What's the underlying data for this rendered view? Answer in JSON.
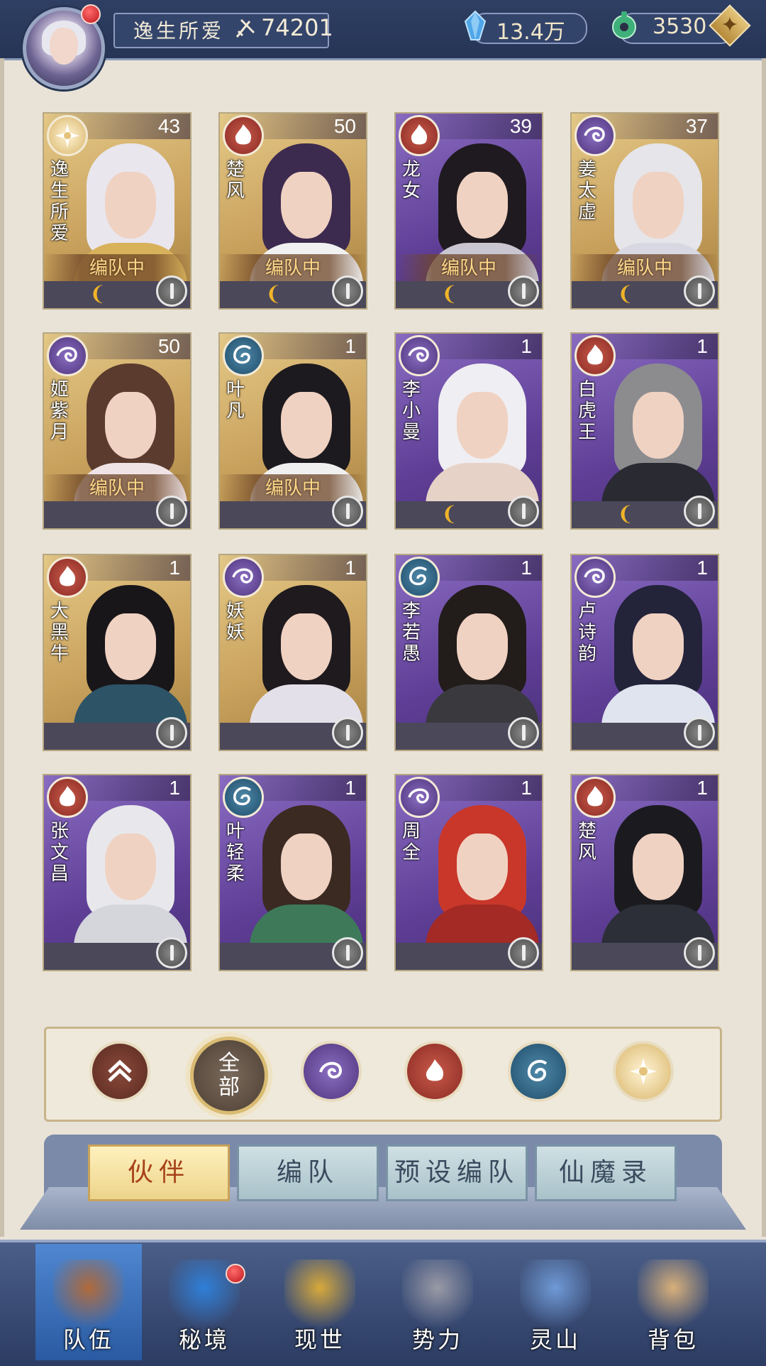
{
  "header": {
    "player_name": "逸生所爱",
    "power": "74201",
    "crystal": "13.4万",
    "jade": "3530",
    "add_symbol": "✦"
  },
  "colors": {
    "fire": "#a3362d",
    "wind": "#6a4f9e",
    "water": "#2e6a8c",
    "light": "#e8cf8e",
    "team_text": "#ffd98a",
    "active_tab": "#ecd48a"
  },
  "roster": [
    {
      "name": "逸生所爱",
      "level": "43",
      "element": "light",
      "team": "编队中",
      "soul": true,
      "bg": "gold",
      "hair": "#e9e6ee",
      "cloth": "#d8b15b"
    },
    {
      "name": "楚风",
      "level": "50",
      "element": "fire",
      "team": "编队中",
      "soul": true,
      "bg": "gold",
      "hair": "#3d2a4f",
      "cloth": "#f1f1f1"
    },
    {
      "name": "龙女",
      "level": "39",
      "element": "fire",
      "team": "编队中",
      "soul": true,
      "bg": "purple",
      "hair": "#1f1a1f",
      "cloth": "#c9c6d2"
    },
    {
      "name": "姜太虚",
      "level": "37",
      "element": "wind",
      "team": "编队中",
      "soul": true,
      "bg": "gold",
      "hair": "#e5e5ea",
      "cloth": "#d8d8e2"
    },
    {
      "name": "姬紫月",
      "level": "50",
      "element": "wind",
      "team": "编队中",
      "soul": false,
      "bg": "gold",
      "hair": "#5a3b2e",
      "cloth": "#efe3e6"
    },
    {
      "name": "叶凡",
      "level": "1",
      "element": "water",
      "team": "编队中",
      "soul": false,
      "bg": "gold",
      "hair": "#1c1a1e",
      "cloth": "#f0f0f0"
    },
    {
      "name": "李小曼",
      "level": "1",
      "element": "wind",
      "team": "",
      "soul": true,
      "bg": "purple",
      "hair": "#efeef2",
      "cloth": "#e6d2c7"
    },
    {
      "name": "白虎王",
      "level": "1",
      "element": "fire",
      "team": "",
      "soul": true,
      "bg": "purple",
      "hair": "#8c8c8f",
      "cloth": "#2a2a33"
    },
    {
      "name": "大黑牛",
      "level": "1",
      "element": "fire",
      "team": "",
      "soul": false,
      "bg": "gold",
      "hair": "#19161a",
      "cloth": "#2d5366"
    },
    {
      "name": "妖妖",
      "level": "1",
      "element": "wind",
      "team": "",
      "soul": false,
      "bg": "gold",
      "hair": "#1e1a1e",
      "cloth": "#e4e0ea"
    },
    {
      "name": "李若愚",
      "level": "1",
      "element": "water",
      "team": "",
      "soul": false,
      "bg": "purple",
      "hair": "#221c1a",
      "cloth": "#3a3a3e"
    },
    {
      "name": "卢诗韵",
      "level": "1",
      "element": "wind",
      "team": "",
      "soul": false,
      "bg": "purple",
      "hair": "#23233a",
      "cloth": "#dfe4ee"
    },
    {
      "name": "张文昌",
      "level": "1",
      "element": "fire",
      "team": "",
      "soul": false,
      "bg": "purple",
      "hair": "#e8e8ec",
      "cloth": "#d5d5dc"
    },
    {
      "name": "叶轻柔",
      "level": "1",
      "element": "water",
      "team": "",
      "soul": false,
      "bg": "purple",
      "hair": "#3b2a22",
      "cloth": "#3e7a5a"
    },
    {
      "name": "周全",
      "level": "1",
      "element": "wind",
      "team": "",
      "soul": false,
      "bg": "purple",
      "hair": "#c8372a",
      "cloth": "#a32a25"
    },
    {
      "name": "楚风",
      "level": "1",
      "element": "fire",
      "team": "",
      "soul": false,
      "bg": "purple",
      "hair": "#1b1b1f",
      "cloth": "#2d2f38"
    }
  ],
  "filters": {
    "sort_icon": "chevron-up-icon",
    "all_label": "全部",
    "elements": [
      "wind",
      "fire",
      "water",
      "light"
    ]
  },
  "tabs": [
    "伙伴",
    "编队",
    "预设编队",
    "仙魔录"
  ],
  "active_tab": 0,
  "nav": [
    {
      "label": "队伍",
      "icon": "team-icon",
      "color": "#b06a3a",
      "active": true
    },
    {
      "label": "秘境",
      "icon": "vortex-icon",
      "color": "#2f7fd8",
      "active": false
    },
    {
      "label": "现世",
      "icon": "scroll-icon",
      "color": "#d8a93a",
      "active": false
    },
    {
      "label": "势力",
      "icon": "temple-icon",
      "color": "#9a9aa6",
      "active": false
    },
    {
      "label": "灵山",
      "icon": "mountain-icon",
      "color": "#6f9ad6",
      "active": false
    },
    {
      "label": "背包",
      "icon": "bag-icon",
      "color": "#d8b07a",
      "active": false
    }
  ]
}
